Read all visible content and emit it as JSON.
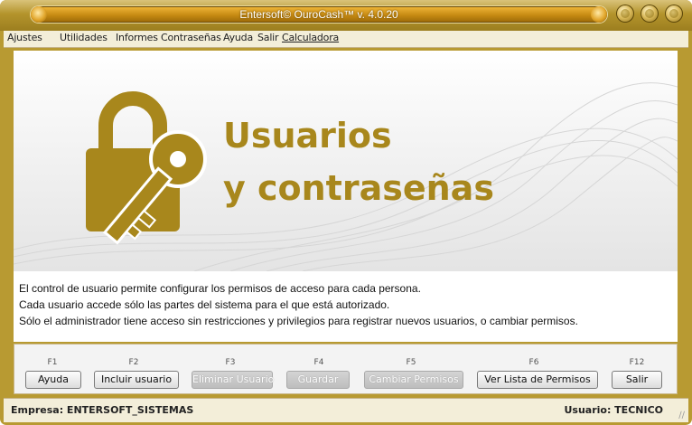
{
  "window": {
    "title": "Entersoft© OuroCash™ v. 4.0.20",
    "controls": [
      "minimize-icon",
      "maximize-icon",
      "close-icon"
    ]
  },
  "menu": {
    "items": [
      "Ajustes",
      "Utilidades",
      "Informes",
      "Contraseñas",
      "Ayuda",
      "Salir",
      "Calculadora"
    ]
  },
  "banner": {
    "line1": "Usuarios",
    "line2": "y contraseñas",
    "icon": "lock-key-icon"
  },
  "description": {
    "line1": "El control de usuario permite configurar los permisos de acceso para cada persona.",
    "line2": "Cada usuario accede sólo las partes del sistema para el que está autorizado.",
    "line3": "Sólo el administrador tiene acceso sin restricciones y privilegios para registrar nuevos usuarios, o cambiar permisos."
  },
  "buttons": [
    {
      "key": "F1",
      "label": "Ayuda",
      "enabled": true
    },
    {
      "key": "F2",
      "label": "Incluir usuario",
      "enabled": true
    },
    {
      "key": "F3",
      "label": "Eliminar Usuario",
      "enabled": false
    },
    {
      "key": "F4",
      "label": "Guardar",
      "enabled": false
    },
    {
      "key": "F5",
      "label": "Cambiar Permisos",
      "enabled": false
    },
    {
      "key": "F6",
      "label": "Ver Lista de Permisos",
      "enabled": true
    },
    {
      "key": "F12",
      "label": "Salir",
      "enabled": true
    }
  ],
  "status": {
    "empresa": "Empresa: ENTERSOFT_SISTEMAS",
    "usuario": "Usuario: TECNICO"
  },
  "colors": {
    "accent": "#b89a32",
    "banner_text": "#a8871c"
  }
}
